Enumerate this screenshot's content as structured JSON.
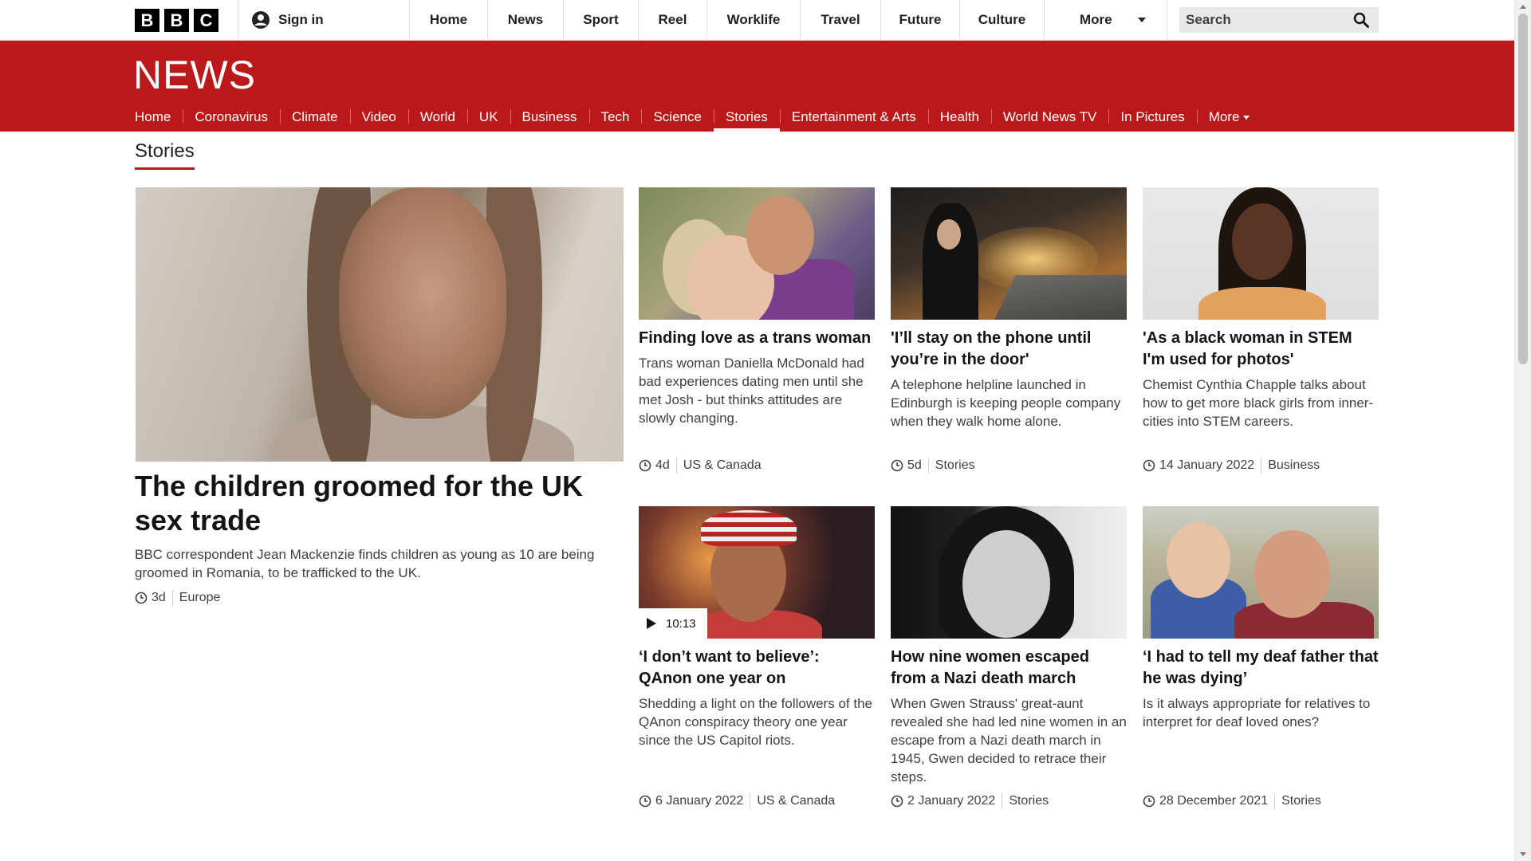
{
  "brand": {
    "logo_letters": [
      "B",
      "B",
      "C"
    ],
    "sign_in": "Sign in",
    "user_icon": "user-icon",
    "colors": {
      "news_red": "#bb1919",
      "active_underline": "#ffffff"
    }
  },
  "topnav": {
    "items": [
      "Home",
      "News",
      "Sport",
      "Reel",
      "Worklife",
      "Travel",
      "Future",
      "Culture"
    ],
    "more": "More",
    "more_icon": "chevron-down-icon"
  },
  "search": {
    "placeholder": "Search",
    "icon": "search-icon"
  },
  "news_header": {
    "logo": "NEWS",
    "nav": [
      "Home",
      "Coronavirus",
      "Climate",
      "Video",
      "World",
      "UK",
      "Business",
      "Tech",
      "Science",
      "Stories",
      "Entertainment & Arts",
      "Health",
      "World News TV",
      "In Pictures"
    ],
    "active": "Stories",
    "more": "More"
  },
  "section": {
    "title": "Stories"
  },
  "lead": {
    "title": "The children groomed for the UK sex trade",
    "summary": "BBC correspondent Jean Mackenzie finds children as young as 10 are being groomed in Romania, to be trafficked to the UK.",
    "time": "3d",
    "category": "Europe"
  },
  "cards": [
    {
      "title": "Finding love as a trans woman",
      "summary": "Trans woman Daniella McDonald had bad experiences dating men until she met Josh - but thinks attitudes are slowly changing.",
      "time": "4d",
      "category": "US & Canada"
    },
    {
      "title": "'I’ll stay on the phone until you’re in the door'",
      "summary": "A telephone helpline launched in Edinburgh is keeping people company when they walk home alone.",
      "time": "5d",
      "category": "Stories"
    },
    {
      "title": "'As a black woman in STEM I'm used for photos'",
      "summary": "Chemist Cynthia Chapple talks about how to get more black girls from inner-cities into STEM careers.",
      "time": "14 January 2022",
      "category": "Business"
    },
    {
      "title": "‘I don’t want to believe’: QAnon one year on",
      "summary": "Shedding a light on the followers of the QAnon conspiracy theory one year since the US Capitol riots.",
      "time": "6 January 2022",
      "category": "US & Canada",
      "video_duration": "10:13"
    },
    {
      "title": "How nine women escaped from a Nazi death march",
      "summary": "When Gwen Strauss' great-aunt revealed she had led nine women in an escape from a Nazi death march in 1945, Gwen decided to retrace their steps.",
      "time": "2 January 2022",
      "category": "Stories"
    },
    {
      "title": "‘I had to tell my deaf father that he was dying’",
      "summary": "Is it always appropriate for relatives to interpret for deaf loved ones?",
      "time": "28 December 2021",
      "category": "Stories"
    }
  ]
}
